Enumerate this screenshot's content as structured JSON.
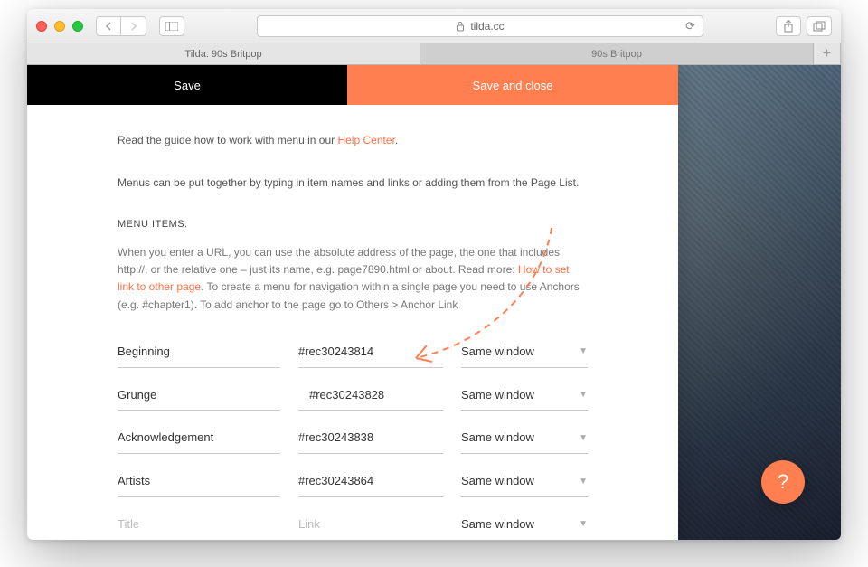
{
  "browser": {
    "address": "tilda.cc",
    "tabs": [
      "Tilda: 90s Britpop",
      "90s Britpop"
    ]
  },
  "panel": {
    "save_label": "Save",
    "save_close_label": "Save and close",
    "guide_prefix": "Read the guide how to work with menu in our ",
    "guide_link": "Help Center",
    "guide_suffix": ".",
    "desc": "Menus can be put together by typing in item names and links or adding them from the Page List.",
    "section_title": "MENU ITEMS:",
    "helper_before": "When you enter a URL, you can use the absolute address of the page, the one that includes http://, or the relative one – just its name, e.g. page7890.html or about. Read more: ",
    "helper_link": "How to set link to other page",
    "helper_after": ". To create a menu for navigation within a single page you need to use Anchors (e.g. #chapter1). To add anchor to the page go to Others > Anchor Link",
    "rows": [
      {
        "title": "Beginning",
        "link": "#rec30243814",
        "target": "Same window"
      },
      {
        "title": "Grunge",
        "link": "#rec30243828",
        "target": "Same window"
      },
      {
        "title": "Acknowledgement",
        "link": "#rec30243838",
        "target": "Same window"
      },
      {
        "title": "Artists",
        "link": "#rec30243864",
        "target": "Same window"
      },
      {
        "title": "",
        "link": "",
        "target": "Same window"
      }
    ],
    "placeholders": {
      "title": "Title",
      "link": "Link"
    }
  },
  "fab": {
    "label": "?"
  }
}
